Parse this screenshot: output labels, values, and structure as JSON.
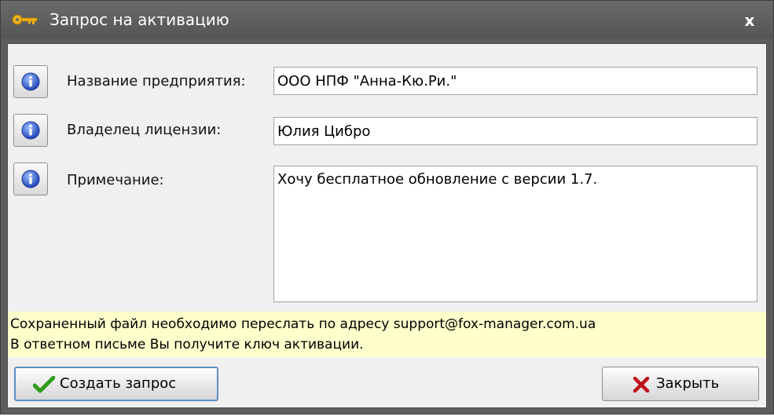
{
  "window": {
    "title": "Запрос на активацию",
    "close_glyph": "x",
    "title_icon": "key-icon"
  },
  "form": {
    "company": {
      "label": "Название предприятия:",
      "value": "ООО НПФ \"Анна-Кю.Ри.\""
    },
    "owner": {
      "label": "Владелец лицензии:",
      "value": "Юлия Цибро"
    },
    "note": {
      "label": "Примечание:",
      "value": "Хочу бесплатное обновление с версии 1.7."
    },
    "info_icon": "info-icon"
  },
  "notice": {
    "line1": "Сохраненный файл необходимо переслать по адресу support@fox-manager.com.ua",
    "line2": "В ответном письме Вы получите ключ активации.",
    "background": "#ffffcc"
  },
  "buttons": {
    "create": {
      "label": "Создать запрос",
      "icon": "checkmark-icon"
    },
    "close": {
      "label": "Закрыть",
      "icon": "x-icon"
    }
  },
  "colors": {
    "titlebar": "#5d5d5d",
    "check_green": "#2e9a1a",
    "x_red": "#c0101a",
    "info_blue": "#2e55c4"
  }
}
